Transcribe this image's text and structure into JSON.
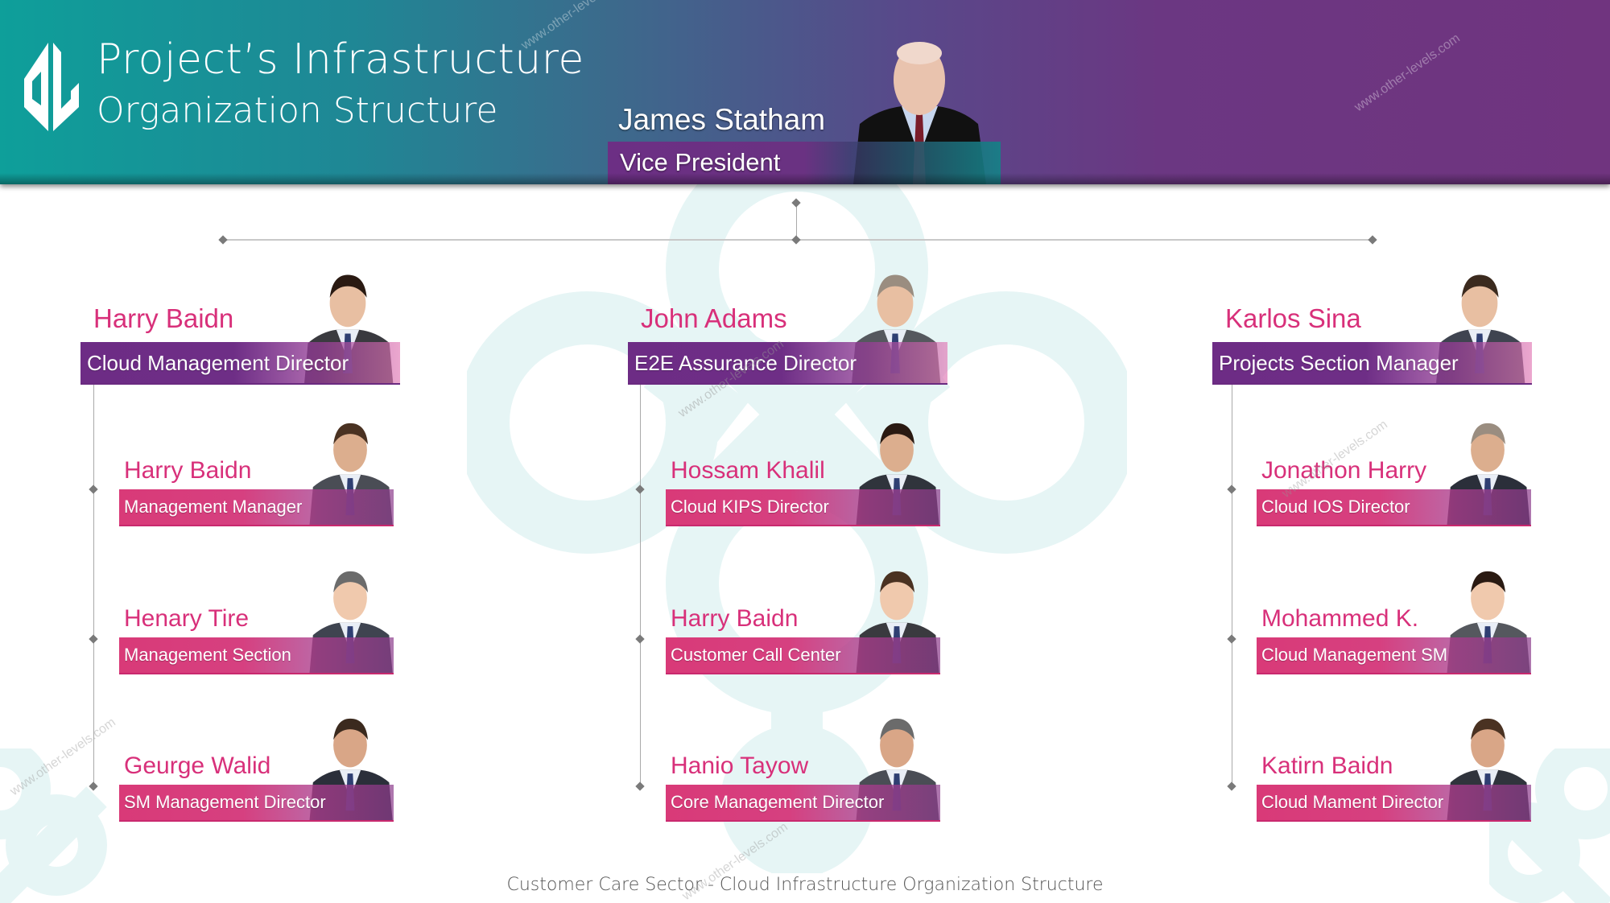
{
  "header": {
    "title_line1": "Project’s Infrastructure",
    "title_line2": "Organization Structure",
    "logo_icon": "ol-monogram-logo",
    "watermark": "www.other-levels.com"
  },
  "colors": {
    "header_gradient_start": "#0e9f9a",
    "header_gradient_end": "#70347f",
    "lead_bar": "#6d2c85",
    "sub_bar": "#d93a78",
    "name_text": "#d8307a",
    "connector": "#a9a9a9",
    "background_pattern": "#e6f5f5"
  },
  "vice_president": {
    "name": "James Statham",
    "title": "Vice President",
    "photo_icon": "portrait-photo"
  },
  "departments": [
    {
      "lead": {
        "name": "Harry Baidn",
        "title": "Cloud Management Director"
      },
      "members": [
        {
          "name": "Harry Baidn",
          "title": "Management Manager"
        },
        {
          "name": "Henary Tire",
          "title": "Management Section"
        },
        {
          "name": "Geurge Walid",
          "title": "SM Management Director"
        }
      ]
    },
    {
      "lead": {
        "name": "John Adams",
        "title": "E2E Assurance Director"
      },
      "members": [
        {
          "name": "Hossam Khalil",
          "title": "Cloud KIPS Director"
        },
        {
          "name": "Harry Baidn",
          "title": "Customer Call Center"
        },
        {
          "name": "Hanio Tayow",
          "title": "Core Management Director"
        }
      ]
    },
    {
      "lead": {
        "name": "Karlos Sina",
        "title": "Projects Section Manager"
      },
      "members": [
        {
          "name": "Jonathon Harry",
          "title": "Cloud IOS Director"
        },
        {
          "name": "Mohammed K.",
          "title": "Cloud Management SM"
        },
        {
          "name": "Katirn Baidn",
          "title": "Cloud Mament Director"
        }
      ]
    }
  ],
  "footer": {
    "caption": "Customer Care Sector - Cloud Infrastructure Organization Structure"
  }
}
